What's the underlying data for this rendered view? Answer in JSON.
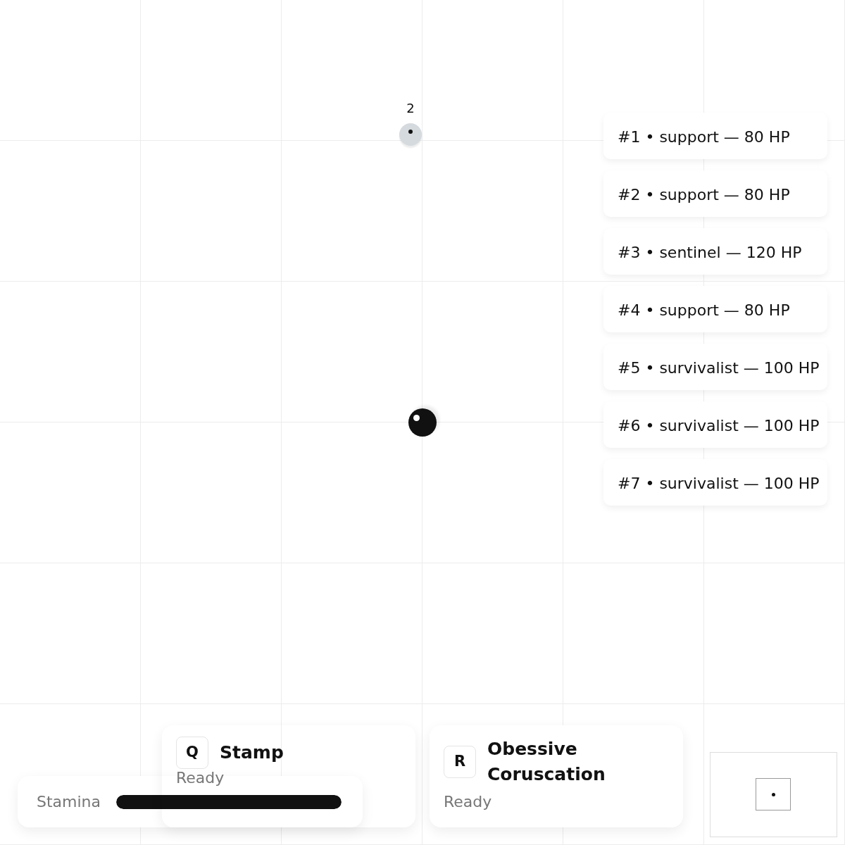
{
  "entities": [
    {
      "kind": "ally",
      "label": "2"
    },
    {
      "kind": "player"
    }
  ],
  "roster": [
    {
      "text": "#1 • support — 80 HP"
    },
    {
      "text": "#2 • support — 80 HP"
    },
    {
      "text": "#3 • sentinel — 120 HP"
    },
    {
      "text": "#4 • support — 80 HP"
    },
    {
      "text": "#5 • survivalist — 100 HP"
    },
    {
      "text": "#6 • survivalist — 100 HP"
    },
    {
      "text": "#7 • survivalist — 100 HP"
    }
  ],
  "stamina": {
    "label": "Stamina",
    "level": 1
  },
  "abilities": [
    {
      "key": "Q",
      "name": "Stamp",
      "status": "Ready"
    },
    {
      "key": "R",
      "name": "Obessive Coruscation",
      "status": "Ready"
    }
  ]
}
